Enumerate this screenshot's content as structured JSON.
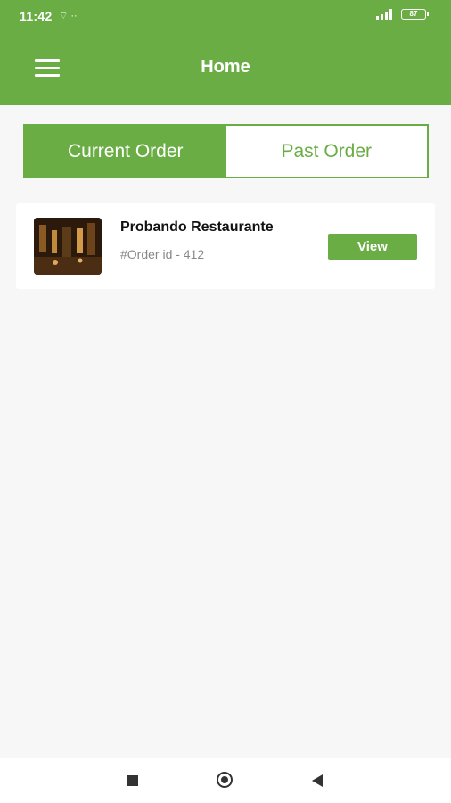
{
  "status_bar": {
    "time": "11:42",
    "left_icons": "⌔ ··",
    "battery": "87"
  },
  "header": {
    "title": "Home"
  },
  "tabs": [
    {
      "label": "Current Order",
      "active": true
    },
    {
      "label": "Past Order",
      "active": false
    }
  ],
  "orders": [
    {
      "restaurant": "Probando Restaurante",
      "order_id": "#Order id - 412",
      "action": "View"
    }
  ],
  "colors": {
    "accent": "#6aad45",
    "background": "#f7f7f7"
  }
}
